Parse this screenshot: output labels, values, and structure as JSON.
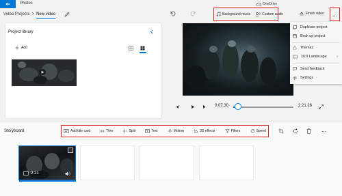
{
  "app": {
    "title": "Photos",
    "cloud": "OneDrive"
  },
  "breadcrumb": {
    "parent": "Video Projects",
    "separator": ">",
    "current": "New video"
  },
  "toolbar": {
    "background_music": "Background music",
    "custom_audio": "Custom audio",
    "finish_video": "Finish video",
    "more": "..."
  },
  "library": {
    "title": "Project library",
    "add": "Add"
  },
  "menu": {
    "items": [
      {
        "label": "Duplicate project",
        "icon": "duplicate-icon"
      },
      {
        "label": "Back up project",
        "icon": "backup-icon"
      },
      {
        "label": "Themes",
        "icon": "themes-icon"
      },
      {
        "label": "16:9 Landscape",
        "icon": "aspect-ratio-icon"
      },
      {
        "label": "Send feedback",
        "icon": "feedback-icon"
      },
      {
        "label": "Settings",
        "icon": "settings-icon"
      }
    ]
  },
  "playback": {
    "current_time": "0:07.30",
    "total_time": "2:21.26",
    "progress": 0.055
  },
  "storyboard": {
    "title": "Storyboard",
    "tools": [
      {
        "label": "Add title card",
        "icon": "title-card-icon"
      },
      {
        "label": "Trim",
        "icon": "trim-icon"
      },
      {
        "label": "Split",
        "icon": "split-icon"
      },
      {
        "label": "Text",
        "icon": "text-icon"
      },
      {
        "label": "Motion",
        "icon": "motion-icon"
      },
      {
        "label": "3D effects",
        "icon": "3d-effects-icon"
      },
      {
        "label": "Filters",
        "icon": "filters-icon"
      },
      {
        "label": "Speed",
        "icon": "speed-icon"
      }
    ],
    "clip": {
      "duration": "2:21"
    }
  },
  "colors": {
    "accent": "#0078d7",
    "highlight": "#e02020"
  }
}
